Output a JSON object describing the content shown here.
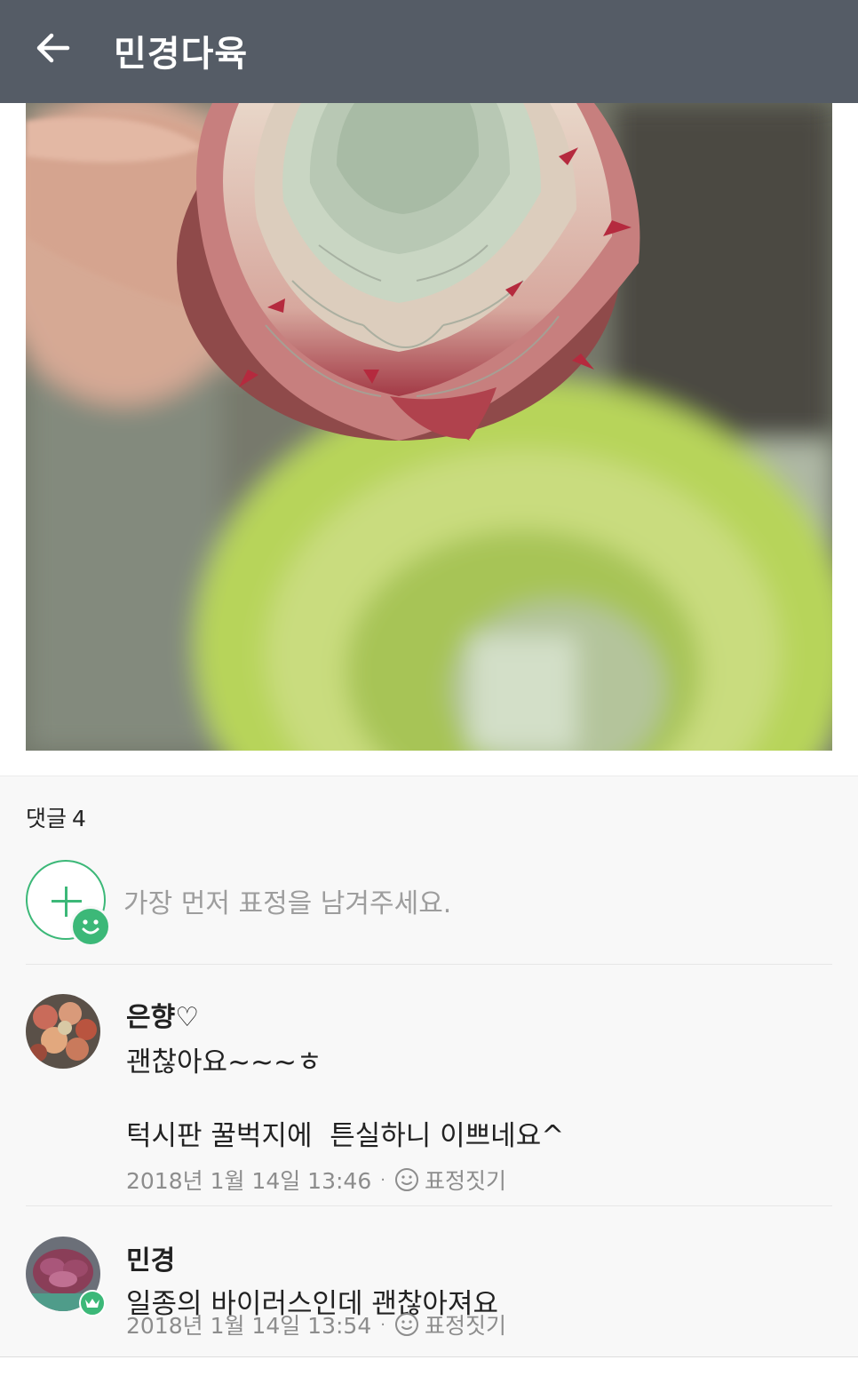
{
  "header": {
    "title": "민경다육",
    "back_icon": "arrow-left-icon"
  },
  "post": {
    "photo_icon": "succulent-photo"
  },
  "comments_section": {
    "label": "댓글",
    "count": "4",
    "reaction_prompt": "가장 먼저 표정을 남겨주세요.",
    "reaction_icon": "add-reaction-icon"
  },
  "comments": [
    {
      "author": "은향♡",
      "line1": "괜찮아요~~~ㅎ",
      "line2": "턱시판 꿀벅지에  튼실하니 이쁘네요^",
      "timestamp": "2018년 1월 14일 13:46",
      "react_label": "표정짓기"
    },
    {
      "author": "민경",
      "line1": "일종의 바이러스인데 괜찮아져요",
      "timestamp": "2018년 1월 14일 13:54",
      "react_label": "표정짓기",
      "badge": "crown-icon"
    }
  ],
  "colors": {
    "header_bg": "#555c66",
    "accent_green": "#3cb878"
  }
}
